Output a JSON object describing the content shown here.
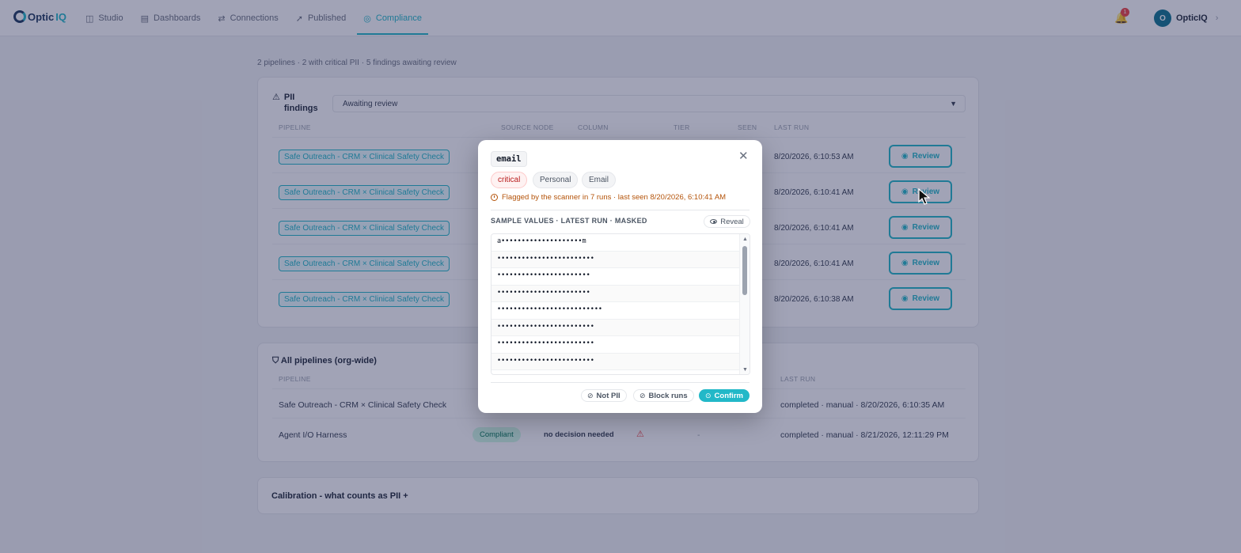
{
  "nav": {
    "brand": "Optic",
    "brand_accent": "IQ",
    "items": [
      {
        "label": "Studio",
        "icon": "studio-icon",
        "glyph": "◫"
      },
      {
        "label": "Dashboards",
        "icon": "dashboard-icon",
        "glyph": "▤"
      },
      {
        "label": "Connections",
        "icon": "connections-icon",
        "glyph": "⇄"
      },
      {
        "label": "Published",
        "icon": "rocket-icon",
        "glyph": "➚"
      },
      {
        "label": "Compliance",
        "icon": "shield-icon",
        "glyph": "◎"
      }
    ],
    "notification_count": "1",
    "user_initial": "O",
    "user_name": "OpticIQ"
  },
  "summary": "2 pipelines · 2 with critical PII · 5 findings awaiting review",
  "pii_findings": {
    "title": "PII findings",
    "filter_value": "Awaiting review",
    "columns": [
      "Pipeline",
      "Source node",
      "Column",
      "Tier",
      "Seen",
      "Last run"
    ],
    "rows": [
      {
        "pipeline": "Safe Outreach - CRM × Clinical Safety Check",
        "last_run": "8/20/2026, 6:10:53 AM",
        "action": "Review"
      },
      {
        "pipeline": "Safe Outreach - CRM × Clinical Safety Check",
        "last_run": "8/20/2026, 6:10:41 AM",
        "action": "Review"
      },
      {
        "pipeline": "Safe Outreach - CRM × Clinical Safety Check",
        "last_run": "8/20/2026, 6:10:41 AM",
        "action": "Review"
      },
      {
        "pipeline": "Safe Outreach - CRM × Clinical Safety Check",
        "last_run": "8/20/2026, 6:10:41 AM",
        "action": "Review"
      },
      {
        "pipeline": "Safe Outreach - CRM × Clinical Safety Check",
        "last_run": "8/20/2026, 6:10:38 AM",
        "action": "Review"
      }
    ]
  },
  "all_pipelines": {
    "title": "All pipelines (org-wide)",
    "columns": [
      "Pipeline",
      "Last run"
    ],
    "rows": [
      {
        "pipeline": "Safe Outreach - CRM × Clinical Safety Check",
        "status": "",
        "decision": "",
        "last_run": "completed · manual · 8/20/2026, 6:10:35 AM"
      },
      {
        "pipeline": "Agent I/O Harness",
        "status": "Compliant",
        "decision": "no decision needed",
        "dash": "-",
        "last_run": "completed · manual · 8/21/2026, 12:11:29 PM"
      }
    ]
  },
  "calibration": {
    "title": "Calibration - what counts as PII +"
  },
  "modal": {
    "column_name": "email",
    "close_glyph": "✕",
    "tags": {
      "tier": "critical",
      "category": "Personal",
      "type": "Email"
    },
    "flag_text": "Flagged by the scanner in 7 runs · last seen 8/20/2026, 6:10:41 AM",
    "samples_label": "SAMPLE VALUES · LATEST RUN · MASKED",
    "reveal_label": "Reveal",
    "samples": [
      "a••••••••••••••••••••m",
      "••••••••••••••••••••••••",
      "•••••••••••••••••••••••",
      "•••••••••••••••••••••••",
      "••••••••••••••••••••••••••",
      "••••••••••••••••••••••••",
      "••••••••••••••••••••••••",
      "••••••••••••••••••••••••"
    ],
    "buttons": {
      "not_pii": "Not PII",
      "block": "Block runs",
      "confirm": "Confirm"
    }
  },
  "colors": {
    "accent": "#22b8c8",
    "critical": "#b91c1c",
    "warning": "#b45309",
    "overlay": "rgba(30,35,80,0.42)"
  }
}
